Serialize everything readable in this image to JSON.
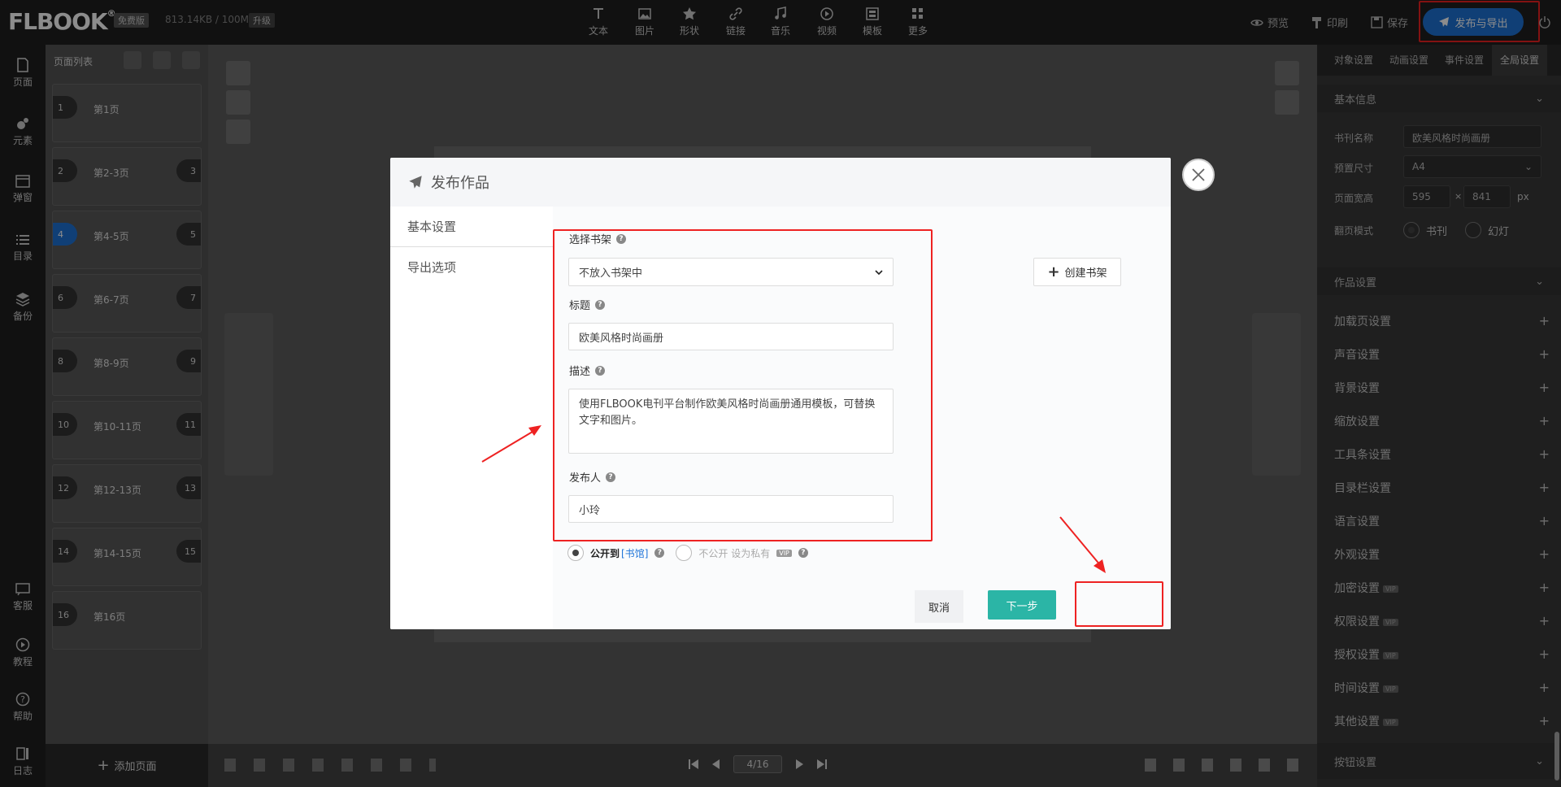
{
  "app": {
    "logo": "FLBOOK",
    "plan_badge": "免费版",
    "storage": "813.14KB / 100M",
    "upgrade": "升级"
  },
  "toolbar": {
    "tools": [
      {
        "label": "文本",
        "icon": "text-icon"
      },
      {
        "label": "图片",
        "icon": "image-icon"
      },
      {
        "label": "形状",
        "icon": "star-icon"
      },
      {
        "label": "链接",
        "icon": "link-icon"
      },
      {
        "label": "音乐",
        "icon": "music-icon"
      },
      {
        "label": "视频",
        "icon": "video-icon"
      },
      {
        "label": "模板",
        "icon": "template-icon"
      },
      {
        "label": "更多",
        "icon": "more-icon"
      }
    ],
    "preview": "预览",
    "print": "印刷",
    "save": "保存",
    "publish": "发布与导出"
  },
  "rail": {
    "top": [
      "页面",
      "元素",
      "弹窗",
      "目录",
      "备份"
    ],
    "bottom": [
      "客服",
      "教程",
      "帮助",
      "日志"
    ]
  },
  "pagelist": {
    "title": "页面列表",
    "pages": [
      {
        "left": "1",
        "label": "第1页",
        "right": ""
      },
      {
        "left": "2",
        "label": "第2-3页",
        "right": "3"
      },
      {
        "left": "4",
        "label": "第4-5页",
        "right": "5",
        "active": true
      },
      {
        "left": "6",
        "label": "第6-7页",
        "right": "7"
      },
      {
        "left": "8",
        "label": "第8-9页",
        "right": "9"
      },
      {
        "left": "10",
        "label": "第10-11页",
        "right": "11"
      },
      {
        "left": "12",
        "label": "第12-13页",
        "right": "13"
      },
      {
        "left": "14",
        "label": "第14-15页",
        "right": "15"
      },
      {
        "left": "16",
        "label": "第16页",
        "right": ""
      }
    ],
    "add_page": "添加页面"
  },
  "pager": {
    "value": "4/16"
  },
  "right_panel": {
    "tabs": [
      "对象设置",
      "动画设置",
      "事件设置",
      "全局设置"
    ],
    "active_tab": 3,
    "basic_info": {
      "title": "基本信息",
      "name_label": "书刊名称",
      "name_value": "欧美风格时尚画册",
      "size_label": "预置尺寸",
      "size_value": "A4",
      "wh_label": "页面宽高",
      "width": "595",
      "times": "×",
      "height": "841",
      "unit": "px",
      "mode_label": "翻页模式",
      "mode_book": "书刊",
      "mode_slide": "幻灯"
    },
    "work_settings_title": "作品设置",
    "items": [
      {
        "label": "加载页设置",
        "vip": false
      },
      {
        "label": "声音设置",
        "vip": false
      },
      {
        "label": "背景设置",
        "vip": false
      },
      {
        "label": "缩放设置",
        "vip": false
      },
      {
        "label": "工具条设置",
        "vip": false
      },
      {
        "label": "目录栏设置",
        "vip": false
      },
      {
        "label": "语言设置",
        "vip": false
      },
      {
        "label": "外观设置",
        "vip": false
      },
      {
        "label": "加密设置",
        "vip": true
      },
      {
        "label": "权限设置",
        "vip": true
      },
      {
        "label": "授权设置",
        "vip": true
      },
      {
        "label": "时间设置",
        "vip": true
      },
      {
        "label": "其他设置",
        "vip": true
      }
    ],
    "vip_label": "VIP",
    "button_settings_title": "按钮设置"
  },
  "modal": {
    "title": "发布作品",
    "tabs": [
      "基本设置",
      "导出选项"
    ],
    "shelf_label": "选择书架",
    "shelf_value": "不放入书架中",
    "create_shelf": "创建书架",
    "title_label": "标题",
    "title_value": "欧美风格时尚画册",
    "desc_label": "描述",
    "desc_value": "使用FLBOOK电刊平台制作欧美风格时尚画册通用模板，可替换文字和图片。",
    "publisher_label": "发布人",
    "publisher_value": "小玲",
    "public_label": "公开到",
    "public_link": "[书馆]",
    "private_label": "不公开 设为私有",
    "private_vip": "VIP",
    "cancel": "取消",
    "next": "下一步"
  },
  "colors": {
    "publish_blue": "#1e74d8",
    "next_teal": "#2bb5a6",
    "highlight_red": "#e22222"
  }
}
